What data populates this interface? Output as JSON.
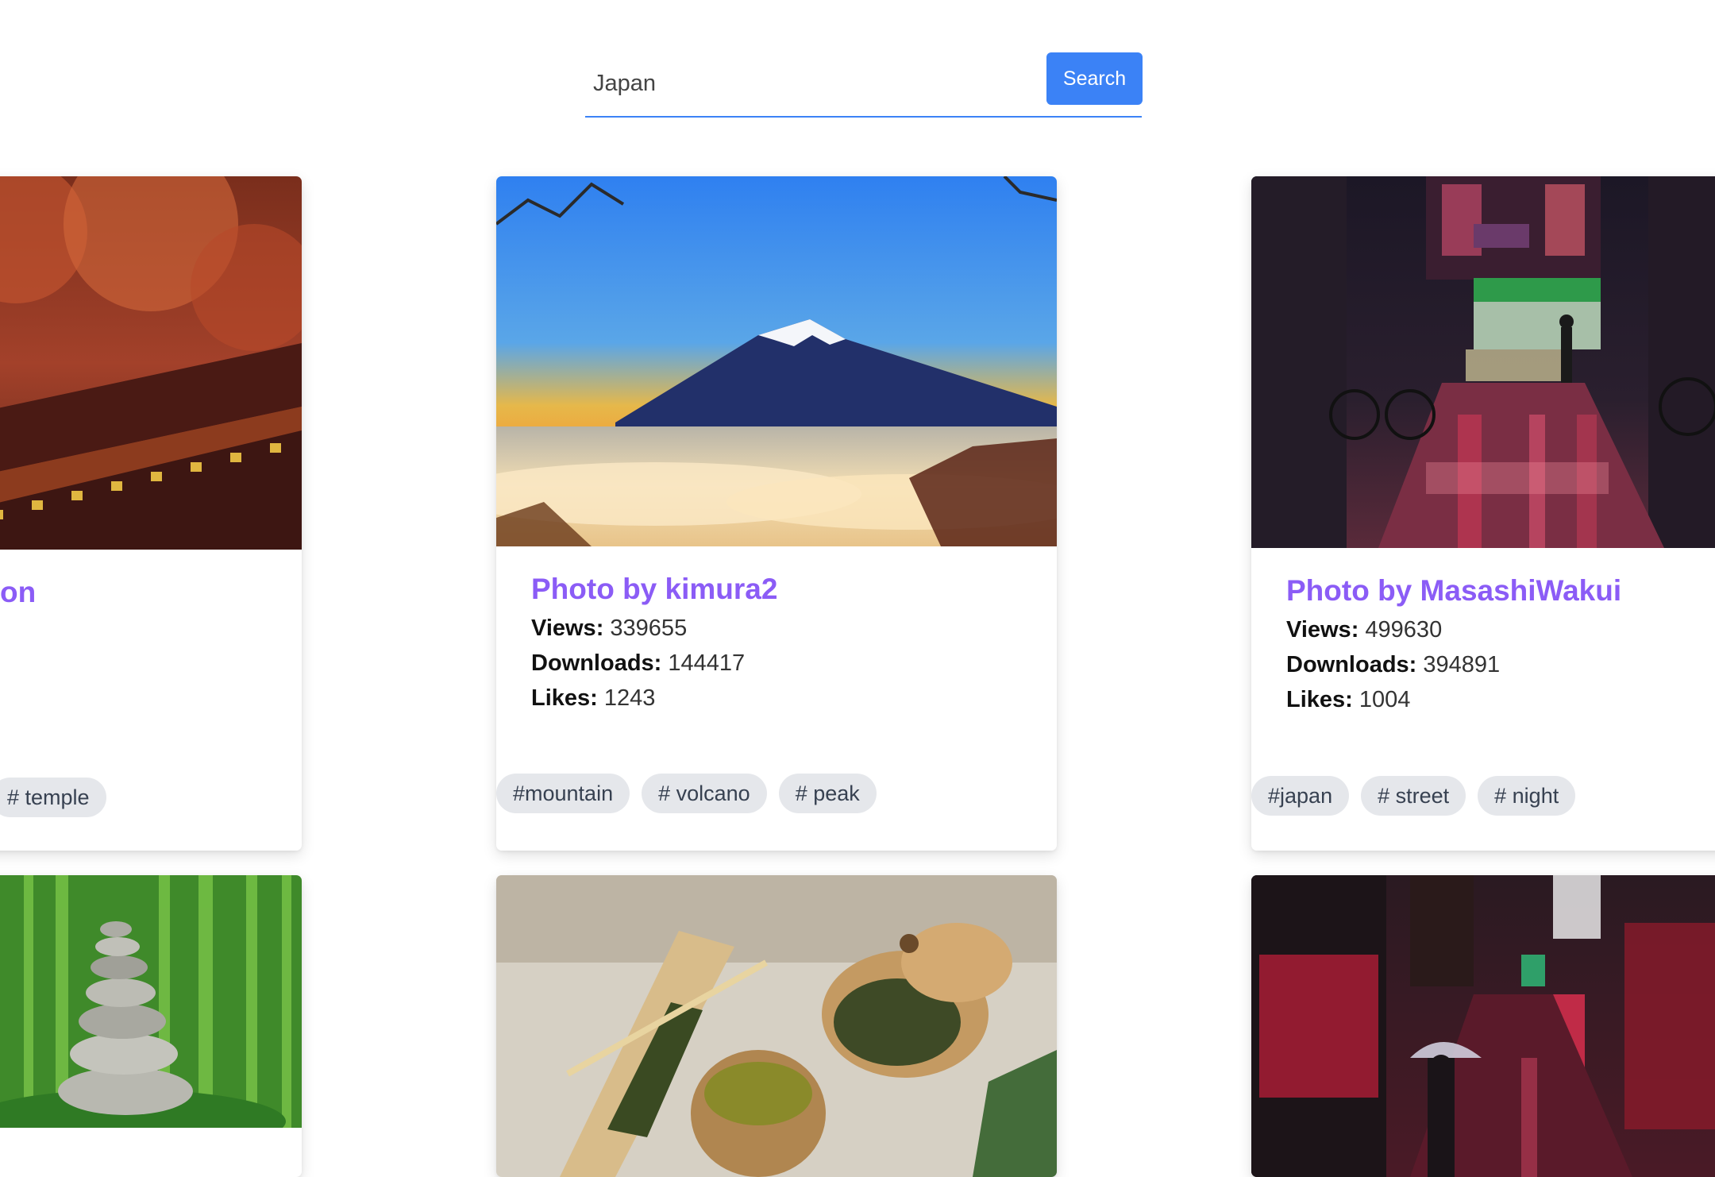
{
  "search": {
    "value": "Japan",
    "button_label": "Search"
  },
  "colors": {
    "accent": "#3b82f6",
    "title": "#8b5cf6",
    "tag_bg": "#e5e7eb"
  },
  "cards": [
    {
      "title_fragment": "on",
      "image": "autumn-temple-photo",
      "tags": [
        "# temple"
      ]
    },
    {
      "title": "Photo by kimura2",
      "image": "mount-fuji-photo",
      "stats": [
        {
          "label": "Views:",
          "value": "339655"
        },
        {
          "label": "Downloads:",
          "value": "144417"
        },
        {
          "label": "Likes:",
          "value": "1243"
        }
      ],
      "tags": [
        "#mountain",
        "# volcano",
        "# peak"
      ]
    },
    {
      "title": "Photo by MasashiWakui",
      "image": "night-street-photo",
      "stats": [
        {
          "label": "Views:",
          "value": "499630"
        },
        {
          "label": "Downloads:",
          "value": "394891"
        },
        {
          "label": "Likes:",
          "value": "1004"
        }
      ],
      "tags": [
        "#japan",
        "# street",
        "# night"
      ]
    },
    {
      "image": "zen-stones-photo"
    },
    {
      "image": "green-tea-photo"
    },
    {
      "image": "alley-umbrella-photo"
    }
  ]
}
